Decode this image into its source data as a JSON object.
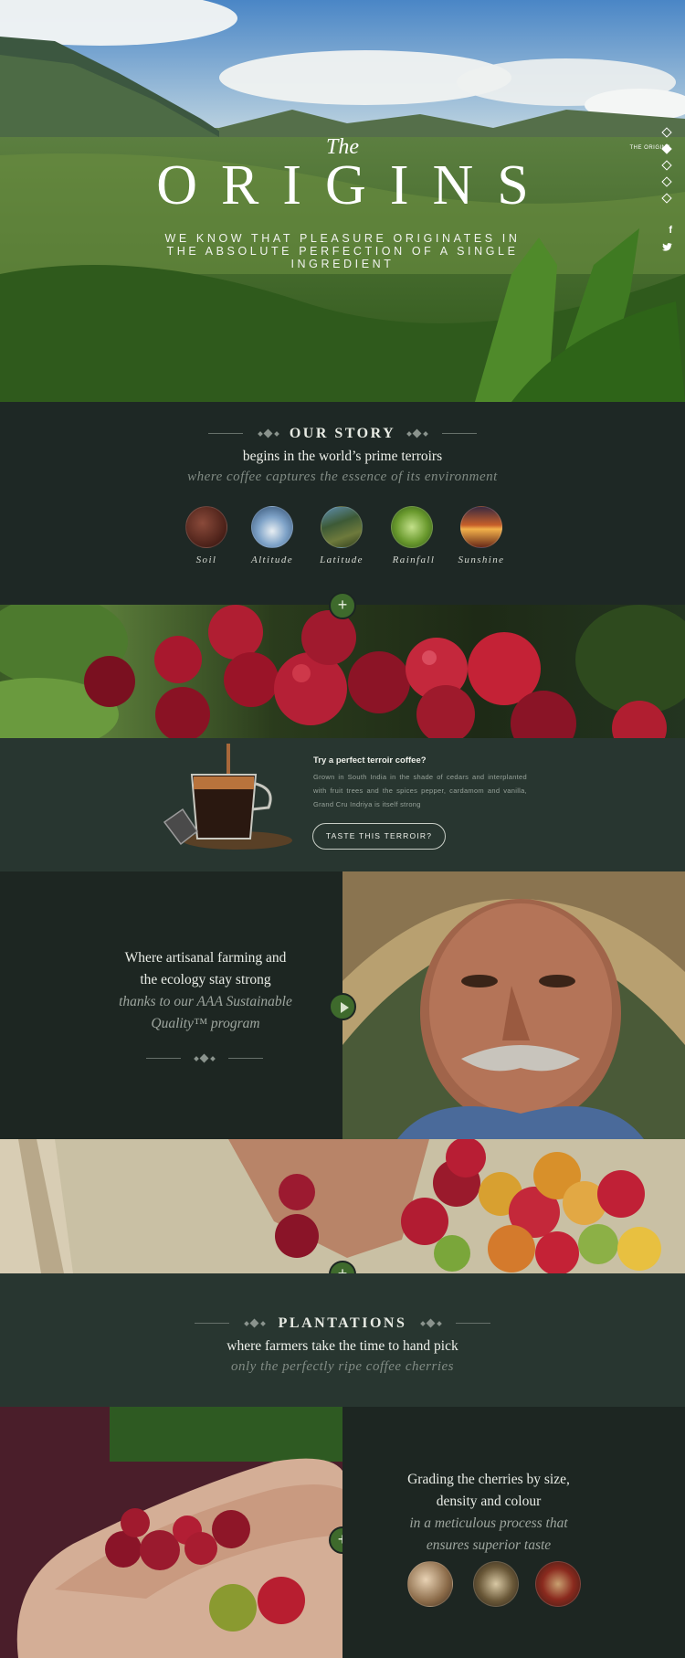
{
  "hero": {
    "title_small": "The",
    "title": "ORIGINS",
    "subtitle": "WE KNOW THAT PLEASURE ORIGINATES IN THE ABSOLUTE PERFECTION OF A SINGLE INGREDIENT",
    "nav_label": "THE ORIGINS",
    "social": [
      "f",
      "t"
    ]
  },
  "story": {
    "heading": "OUR STORY",
    "line1": "begins in the world’s prime terroirs",
    "line2": "where coffee captures the essence of its environment",
    "factors": [
      "Soil",
      "Altitude",
      "Latitude",
      "Rainfall",
      "Sunshine"
    ],
    "plus": "+"
  },
  "terroir": {
    "title": "Try a perfect terroir coffee?",
    "body": "Grown in South India in the shade of cedars and interplanted with fruit trees and the spices pepper, cardamom and vanilla, Grand Cru Indriya is itself strong",
    "button": "TASTE THIS TERROIR?"
  },
  "artisan": {
    "line1": "Where artisanal farming and",
    "line2": "the ecology stay strong",
    "line3": "thanks to our AAA Sustainable",
    "line4": "Quality™ program"
  },
  "plantations": {
    "heading": "PLANTATIONS",
    "line1": "where farmers take the time to hand pick",
    "line2": "only the perfectly ripe coffee cherries",
    "plus": "+"
  },
  "grading": {
    "line1": "Grading the cherries by size,",
    "line2": "density and colour",
    "line3": "in a meticulous process that",
    "line4": "ensures superior taste",
    "plus": "+"
  },
  "colors": {
    "accent_green": "#3e6a2c",
    "dark_bg": "#1d2622",
    "panel_bg": "#283630"
  }
}
